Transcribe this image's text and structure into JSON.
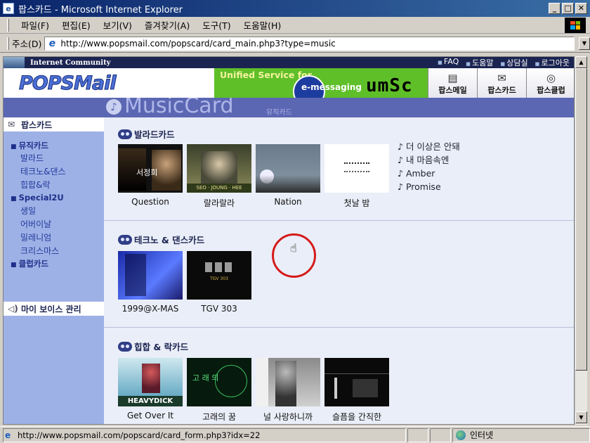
{
  "window": {
    "title": "팝스카드 - Microsoft Internet Explorer",
    "min": "_",
    "max": "□",
    "close": "✕"
  },
  "menu": [
    "파일(F)",
    "편집(E)",
    "보기(V)",
    "즐겨찾기(A)",
    "도구(T)",
    "도움말(H)"
  ],
  "address": {
    "label": "주소(D)",
    "url": "http://www.popsmail.com/popscard/card_main.php3?type=music"
  },
  "site": {
    "community_label": "Internet Community",
    "top_links": [
      "FAQ",
      "도움말",
      "상담실",
      "로그아웃"
    ],
    "logo": "POPSMail",
    "banner": {
      "line1": "Unified Service for",
      "line2": "e-messaging",
      "brand": "umSc"
    },
    "nav": [
      {
        "label": "팝스메일",
        "icon": "mail-icon"
      },
      {
        "label": "팝스카드",
        "icon": "card-icon"
      },
      {
        "label": "팝스클럽",
        "icon": "club-icon"
      }
    ],
    "music_title": "MusicCard",
    "music_subtitle": "뮤직카드"
  },
  "sidebar": {
    "title": "팝스카드",
    "groups": [
      {
        "label": "뮤직카드",
        "items": [
          "발라드",
          "테크노&댄스",
          "힙합&락"
        ]
      },
      {
        "label": "Special2U",
        "items": [
          "생일",
          "어버이날",
          "밀레니엄",
          "크리스마스"
        ]
      },
      {
        "label": "클럽카드",
        "items": []
      }
    ],
    "voice": "마이 보이스 관리"
  },
  "sections": [
    {
      "title": "발라드카드",
      "cards": [
        "Question",
        "랄라랄라",
        "Nation",
        "첫날 밤"
      ]
    },
    {
      "title": "테크노 & 댄스카드",
      "cards": [
        "1999@X-MAS",
        "TGV 303"
      ]
    },
    {
      "title": "힙합 & 락카드",
      "cards": [
        "Get Over It",
        "고래의 꿈",
        "널 사랑하니까",
        "슬픔을 간직한"
      ]
    }
  ],
  "thumb_text": {
    "question": "서정희",
    "lalala": "SEO · JOUNG · HEE",
    "hiphop1": "HEAVYDICK",
    "tgv": "TGV 303",
    "whale": "고 래 의"
  },
  "songs": [
    "더 이상은 안돼",
    "내 마음속엔",
    "Amber",
    "Promise"
  ],
  "status": {
    "url": "http://www.popsmail.com/popscard/card_form.php3?idx=22",
    "zone": "인터넷"
  }
}
